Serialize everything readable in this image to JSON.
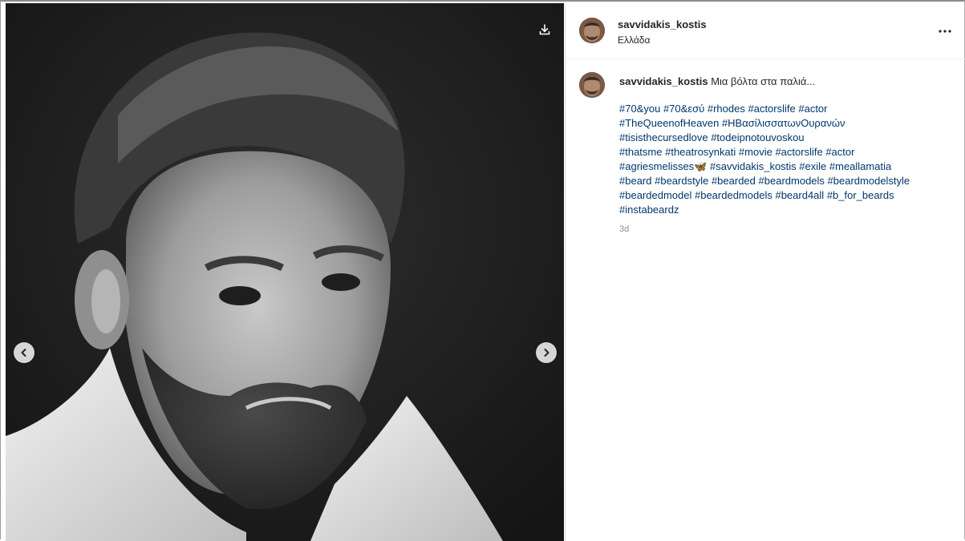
{
  "post": {
    "username": "savvidakis_kostis",
    "location": "Ελλάδα",
    "caption_text": "Μια βόλτα στα παλιά...",
    "time": "3d"
  },
  "tags": [
    [
      "#70&you",
      "#70&εσύ",
      "#rhodes",
      "#actorslife",
      "#actor"
    ],
    [
      "#TheQueenofHeaven",
      "#ΗΒασίλισσατωνΟυρανών"
    ],
    [
      "#tisisthecursedlove",
      "#todeipnotouvoskou"
    ],
    [
      "#thatsme",
      "#theatrosynkati",
      "#movie",
      "#actorslife",
      "#actor"
    ],
    [
      "#agriesmelisses🦋",
      "#savvidakis_kostis",
      "#exile",
      "#meallamatia"
    ],
    [
      "#beard",
      "#beardstyle",
      "#bearded",
      "#beardmodels",
      "#beardmodelstyle"
    ],
    [
      "#beardedmodel",
      "#beardedmodels",
      "#beard4all",
      "#b_for_beards"
    ],
    [
      "#instabeardz"
    ]
  ],
  "icons": {
    "download": "download-icon",
    "prev": "chevron-left-icon",
    "next": "chevron-right-icon",
    "more": "more-options-icon"
  },
  "colors": {
    "hashtag": "#00376b",
    "text": "#262626",
    "muted": "#8e8e8e"
  }
}
